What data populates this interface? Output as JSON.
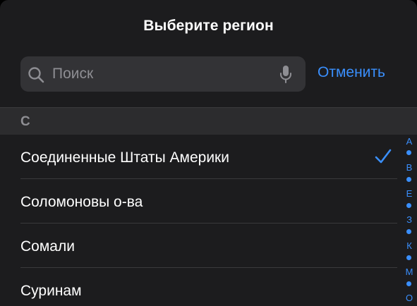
{
  "title": "Выберите регион",
  "search": {
    "placeholder": "Поиск",
    "value": ""
  },
  "cancel_label": "Отменить",
  "section": {
    "letter": "С"
  },
  "regions": [
    {
      "label": "Соединенные Штаты Америки",
      "selected": true
    },
    {
      "label": "Соломоновы о-ва",
      "selected": false
    },
    {
      "label": "Сомали",
      "selected": false
    },
    {
      "label": "Суринам",
      "selected": false
    }
  ],
  "index_letters": [
    "А",
    "В",
    "Е",
    "З",
    "К",
    "М",
    "О"
  ],
  "colors": {
    "accent": "#3a8ffd",
    "background": "#1c1c1e",
    "field": "#333336",
    "section_header": "#2c2c2e",
    "secondary_text": "#8e8e93"
  },
  "icons": {
    "search": "search-icon",
    "mic": "microphone-icon",
    "check": "checkmark-icon"
  }
}
